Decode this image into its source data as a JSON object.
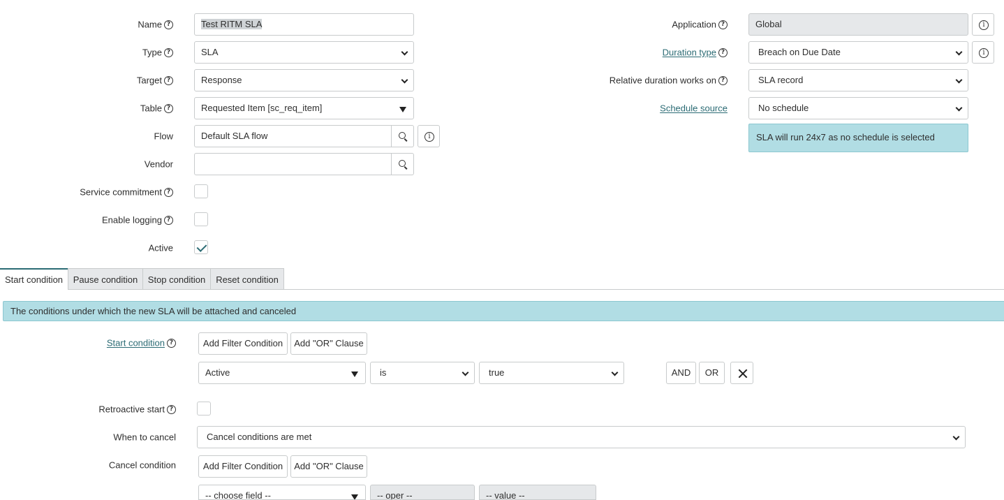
{
  "left_fields": {
    "name": {
      "label": "Name",
      "value": "Test RITM SLA"
    },
    "type": {
      "label": "Type",
      "value": "SLA"
    },
    "target": {
      "label": "Target",
      "value": "Response"
    },
    "table": {
      "label": "Table",
      "value": "Requested Item [sc_req_item]"
    },
    "flow": {
      "label": "Flow",
      "value": "Default SLA flow"
    },
    "vendor": {
      "label": "Vendor",
      "value": ""
    },
    "service_commitment": {
      "label": "Service commitment",
      "checked": false
    },
    "enable_logging": {
      "label": "Enable logging",
      "checked": false
    },
    "active": {
      "label": "Active",
      "checked": true
    }
  },
  "right_fields": {
    "application": {
      "label": "Application",
      "value": "Global"
    },
    "duration_type": {
      "label": "Duration type",
      "value": "Breach on Due Date"
    },
    "relative_duration": {
      "label": "Relative duration works on",
      "value": "SLA record"
    },
    "schedule_source": {
      "label": "Schedule source",
      "value": "No schedule"
    },
    "schedule_note": "SLA will run 24x7 as no schedule is selected"
  },
  "tabs": [
    {
      "label": "Start condition",
      "active": true
    },
    {
      "label": "Pause condition",
      "active": false
    },
    {
      "label": "Stop condition",
      "active": false
    },
    {
      "label": "Reset condition",
      "active": false
    }
  ],
  "start_section": {
    "banner": "The conditions under which the new SLA will be attached and canceled",
    "start_condition_label": "Start condition",
    "add_filter_label": "Add Filter Condition",
    "add_or_label": "Add \"OR\" Clause",
    "condition_row": {
      "field": "Active",
      "operator": "is",
      "value": "true"
    },
    "and_label": "AND",
    "or_label": "OR",
    "retroactive_label": "Retroactive start",
    "when_to_cancel_label": "When to cancel",
    "when_to_cancel_value": "Cancel conditions are met",
    "cancel_condition_label": "Cancel condition",
    "cancel_row": {
      "field": "-- choose field --",
      "operator": "-- oper --",
      "value": "-- value --"
    }
  },
  "help_glyph": "?",
  "info_glyph": "i",
  "colors": {
    "accent": "#2b6b74",
    "banner": "#b1dde4",
    "readonly": "#e6e8ea"
  }
}
